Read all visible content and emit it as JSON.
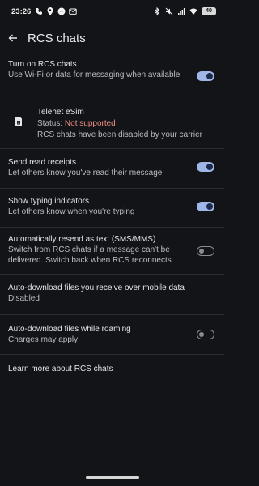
{
  "status_bar": {
    "time": "23:26",
    "battery": "40",
    "left_icons": [
      "call-indicator-icon",
      "location-icon",
      "messenger-icon",
      "gmail-icon"
    ],
    "right_icons": [
      "bluetooth-icon",
      "mute-icon",
      "signal-icon",
      "wifi-icon"
    ]
  },
  "header": {
    "title": "RCS chats"
  },
  "settings": {
    "turn_on": {
      "title": "Turn on RCS chats",
      "subtitle": "Use Wi-Fi or data for messaging when available",
      "enabled": true
    },
    "sim": {
      "name": "Telenet eSim",
      "status_label": "Status:",
      "status_value": "Not supported",
      "note": "RCS chats have been disabled by your carrier"
    },
    "read_receipts": {
      "title": "Send read receipts",
      "subtitle": "Let others know you've read their message",
      "enabled": true
    },
    "typing": {
      "title": "Show typing indicators",
      "subtitle": "Let others know when you're typing",
      "enabled": true
    },
    "resend": {
      "title": "Automatically resend as text (SMS/MMS)",
      "subtitle": "Switch from RCS chats if a message can't be delivered. Switch back when RCS reconnects",
      "enabled": false
    },
    "auto_download_mobile": {
      "title": "Auto-download files you receive over mobile data",
      "subtitle": "Disabled"
    },
    "auto_download_roaming": {
      "title": "Auto-download files while roaming",
      "subtitle": "Charges may apply",
      "enabled": false
    },
    "learn_more": {
      "label": "Learn more about RCS chats"
    }
  },
  "colors": {
    "background": "#131417",
    "switch_on": "#9fb6e8",
    "status_error": "#f08f80"
  }
}
